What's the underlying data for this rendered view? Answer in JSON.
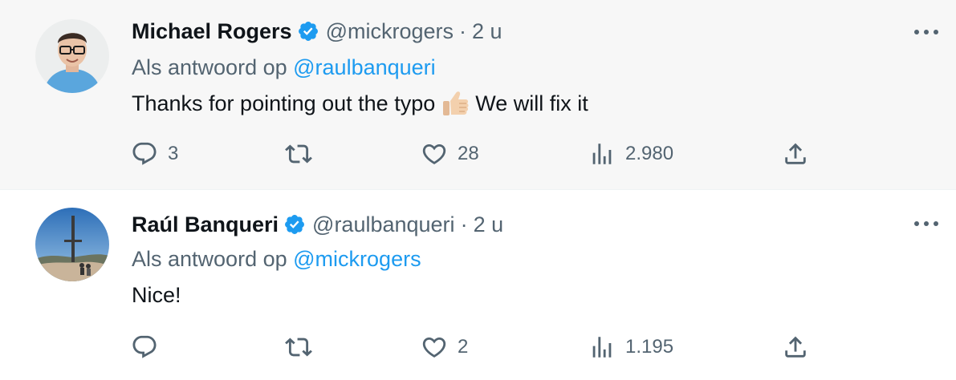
{
  "tweets": [
    {
      "name": "Michael Rogers",
      "handle": "@mickrogers",
      "separator": "·",
      "time": "2 u",
      "reply_prefix": "Als antwoord op",
      "reply_to": "@raulbanqueri",
      "text_before": "Thanks for pointing out the typo",
      "emoji": "thumbs-up-emoji",
      "text_after": "We will fix it",
      "replies": "3",
      "retweets": "",
      "likes": "28",
      "views": "2.980"
    },
    {
      "name": "Raúl Banqueri",
      "handle": "@raulbanqueri",
      "separator": "·",
      "time": "2 u",
      "reply_prefix": "Als antwoord op",
      "reply_to": "@mickrogers",
      "text": "Nice!",
      "replies": "",
      "retweets": "",
      "likes": "2",
      "views": "1.195"
    }
  ],
  "colors": {
    "verified": "#1d9bf0",
    "mention": "#1d9bf0",
    "muted": "#536471",
    "highlight_bg": "#f7f7f7"
  },
  "icons": [
    "verified-badge-icon",
    "more-icon",
    "reply-icon",
    "retweet-icon",
    "like-icon",
    "views-icon",
    "share-icon"
  ]
}
